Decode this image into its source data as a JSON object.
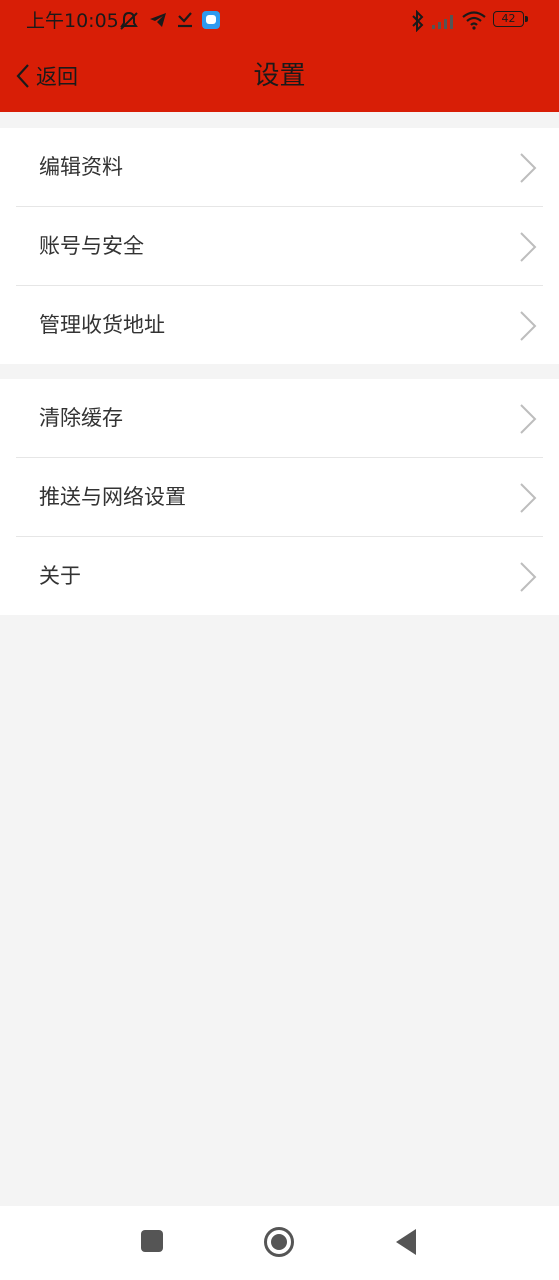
{
  "status_bar": {
    "time": "上午10:05",
    "battery_level": "42",
    "icons": [
      "muted-notification-icon",
      "telegram-icon",
      "download-done-icon",
      "app-notification-icon",
      "bluetooth-icon",
      "signal-icon",
      "wifi-icon",
      "battery-icon"
    ]
  },
  "header": {
    "back_label": "返回",
    "title": "设置",
    "bg_color": "#d81e06"
  },
  "groups": [
    {
      "items": [
        {
          "label": "编辑资料"
        },
        {
          "label": "账号与安全"
        },
        {
          "label": "管理收货地址"
        }
      ]
    },
    {
      "items": [
        {
          "label": "清除缓存"
        },
        {
          "label": "推送与网络设置"
        },
        {
          "label": "关于"
        }
      ]
    }
  ],
  "system_nav": {
    "buttons": [
      "recents-square-icon",
      "home-circle-icon",
      "back-triangle-icon"
    ]
  }
}
